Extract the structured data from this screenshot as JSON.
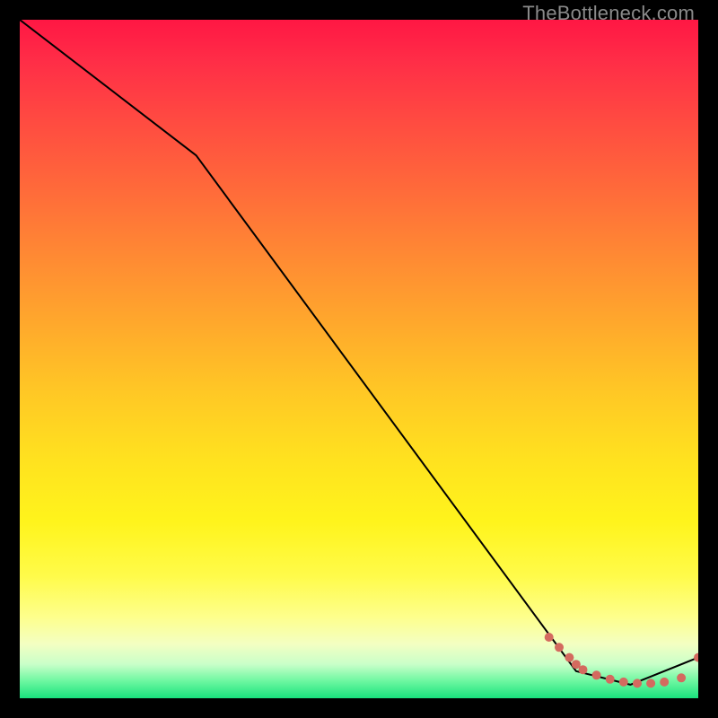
{
  "watermark": "TheBottleneck.com",
  "chart_data": {
    "type": "line",
    "title": "",
    "xlabel": "",
    "ylabel": "",
    "xlim": [
      0,
      100
    ],
    "ylim": [
      0,
      100
    ],
    "grid": false,
    "legend": false,
    "series": [
      {
        "name": "curve",
        "style": "solid-black",
        "x": [
          0,
          26,
          82,
          90,
          100
        ],
        "y": [
          100,
          80,
          4,
          2,
          6
        ]
      },
      {
        "name": "markers",
        "style": "points-salmon",
        "x": [
          78,
          79.5,
          81,
          82,
          83,
          85,
          87,
          89,
          91,
          93,
          95,
          97.5,
          100
        ],
        "y": [
          9,
          7.5,
          6,
          5,
          4.2,
          3.4,
          2.8,
          2.4,
          2.2,
          2.2,
          2.4,
          3.0,
          6
        ]
      }
    ]
  },
  "colors": {
    "line": "#000000",
    "marker": "#d46a5f",
    "background_top": "#ff1744",
    "background_bottom": "#19e27d"
  }
}
